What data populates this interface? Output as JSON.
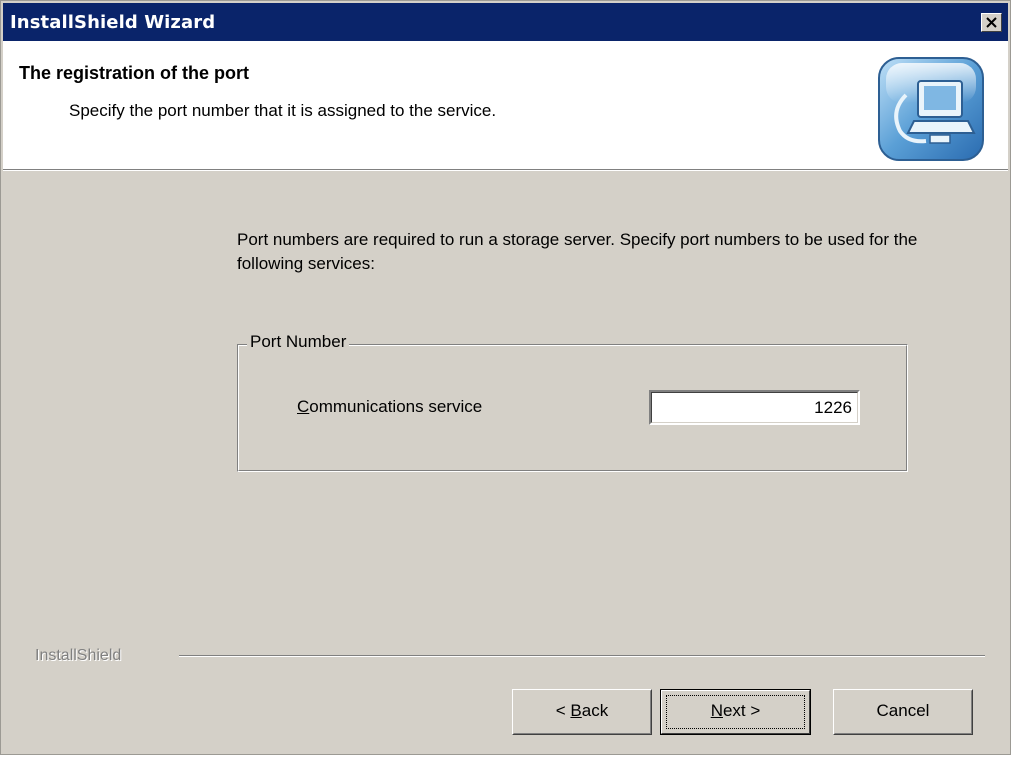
{
  "window": {
    "title": "InstallShield Wizard",
    "close_icon": "close-icon"
  },
  "header": {
    "title": "The registration of the port",
    "subtitle": "Specify the port number that it is assigned to the service.",
    "icon": "computer-setup-icon"
  },
  "body": {
    "description": "Port numbers are required to run a storage server.  Specify port numbers to be used for the following services:",
    "group": {
      "label": "Port Number",
      "fields": [
        {
          "label_accel": "C",
          "label_rest": "ommunications service",
          "value": "1226"
        }
      ]
    }
  },
  "footer": {
    "brand": "InstallShield",
    "buttons": {
      "back_prefix": "< ",
      "back_accel": "B",
      "back_rest": "ack",
      "next_accel": "N",
      "next_rest": "ext >",
      "cancel": "Cancel"
    }
  },
  "colors": {
    "titlebar": "#0a246a",
    "dialog_face": "#d4d0c8",
    "header_bg": "#ffffff"
  }
}
